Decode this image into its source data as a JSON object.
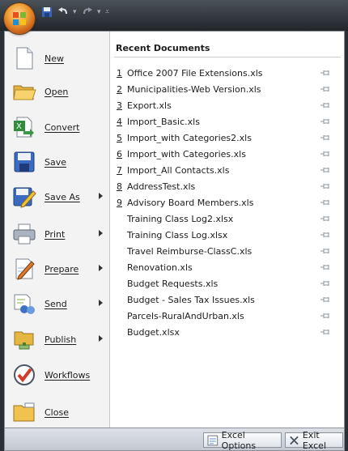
{
  "menu": {
    "recent_title": "Recent Documents",
    "commands": [
      {
        "label": "New",
        "icon": "new-document-icon",
        "submenu": false
      },
      {
        "label": "Open",
        "icon": "open-folder-icon",
        "submenu": false
      },
      {
        "label": "Convert",
        "icon": "convert-icon",
        "submenu": false
      },
      {
        "label": "Save",
        "icon": "save-disk-icon",
        "submenu": false
      },
      {
        "label": "Save As",
        "icon": "save-as-icon",
        "submenu": true
      },
      {
        "label": "Print",
        "icon": "printer-icon",
        "submenu": true
      },
      {
        "label": "Prepare",
        "icon": "prepare-icon",
        "submenu": true
      },
      {
        "label": "Send",
        "icon": "send-icon",
        "submenu": true
      },
      {
        "label": "Publish",
        "icon": "publish-icon",
        "submenu": true
      },
      {
        "label": "Workflows",
        "icon": "workflows-icon",
        "submenu": false
      },
      {
        "label": "Close",
        "icon": "close-folder-icon",
        "submenu": false
      }
    ],
    "recent_documents": [
      {
        "num": "1",
        "name": "Office 2007 File Extensions.xls"
      },
      {
        "num": "2",
        "name": "Municipalities-Web Version.xls"
      },
      {
        "num": "3",
        "name": "Export.xls"
      },
      {
        "num": "4",
        "name": "Import_Basic.xls"
      },
      {
        "num": "5",
        "name": "Import_with Categories2.xls"
      },
      {
        "num": "6",
        "name": "Import_with Categories.xls"
      },
      {
        "num": "7",
        "name": "Import_All Contacts.xls"
      },
      {
        "num": "8",
        "name": "AddressTest.xls"
      },
      {
        "num": "9",
        "name": "Advisory Board Members.xls"
      },
      {
        "num": "",
        "name": "Training Class Log2.xlsx"
      },
      {
        "num": "",
        "name": "Training Class Log.xlsx"
      },
      {
        "num": "",
        "name": "Travel Reimburse-ClassC.xls"
      },
      {
        "num": "",
        "name": "Renovation.xls"
      },
      {
        "num": "",
        "name": "Budget Requests.xls"
      },
      {
        "num": "",
        "name": "Budget - Sales Tax Issues.xls"
      },
      {
        "num": "",
        "name": "Parcels-RuralAndUrban.xls"
      },
      {
        "num": "",
        "name": "Budget.xlsx"
      }
    ]
  },
  "bottom": {
    "excel_options": "Excel Options",
    "exit_excel": "Exit Excel"
  },
  "colors": {
    "accent_orange": "#f2a33b",
    "titlebar": "#2b2f36",
    "command_pane": "#f3f3f3"
  }
}
